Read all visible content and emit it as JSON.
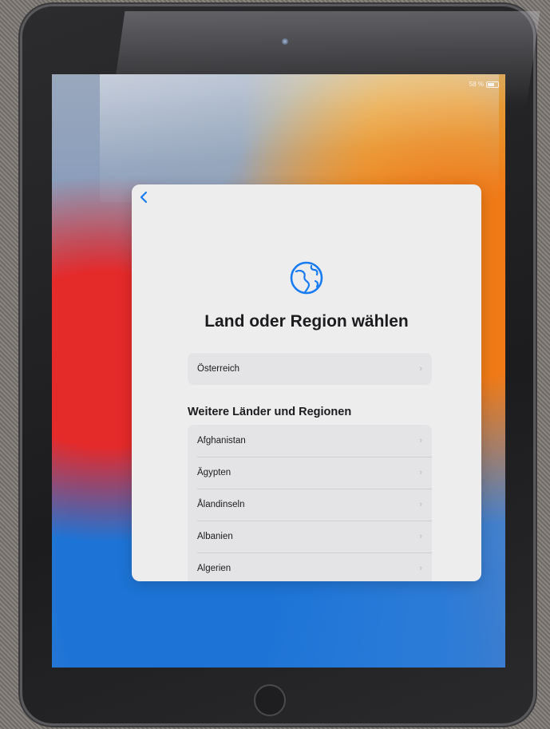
{
  "status": {
    "battery_text": "58 %"
  },
  "nav": {
    "back_label": "<"
  },
  "page": {
    "title": "Land oder Region wählen"
  },
  "suggested": {
    "items": [
      {
        "label": "Österreich"
      }
    ]
  },
  "others": {
    "section_title": "Weitere Länder und Regionen",
    "items": [
      {
        "label": "Afghanistan"
      },
      {
        "label": "Ägypten"
      },
      {
        "label": "Ålandinseln"
      },
      {
        "label": "Albanien"
      },
      {
        "label": "Algerien"
      }
    ]
  },
  "icons": {
    "globe": "globe-icon",
    "chevron": "chevron-right-icon",
    "back": "chevron-left-icon"
  },
  "colors": {
    "accent": "#1a7cf2",
    "sheet_bg": "#ededee",
    "row_bg": "#e4e4e6"
  }
}
